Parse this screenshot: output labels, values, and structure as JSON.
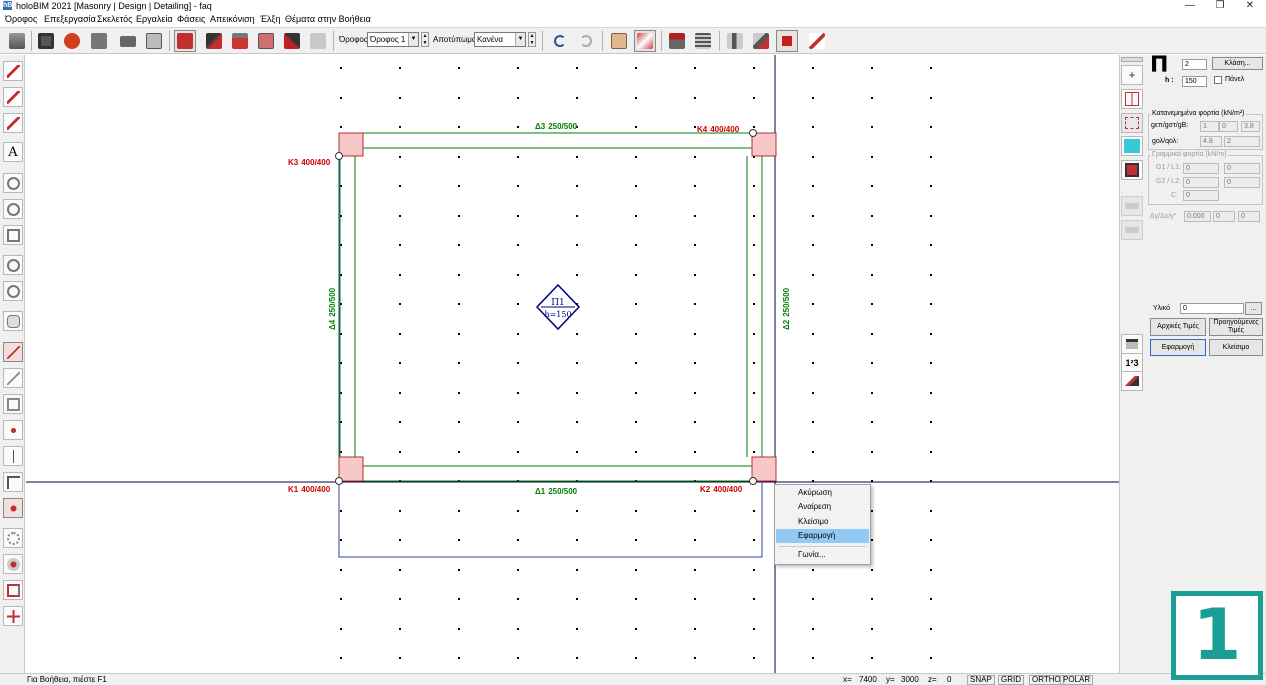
{
  "window": {
    "title": "holoBIM 2021 [Masonry | Design | Detailing] - faq",
    "app_icon": "hB",
    "controls": {
      "minimize": "—",
      "maximize": "❐",
      "close": "✕"
    }
  },
  "menu": [
    "Όροφος",
    "Επεξεργασία",
    "Σκελετός",
    "Εργαλεία",
    "Φάσεις",
    "Απεικόνιση",
    "Έλξη",
    "Θέματα στην Βοήθεια"
  ],
  "toolbar": {
    "floor_label": "Όροφος",
    "floor_value": "Όροφος 1",
    "imprint_label": "Αποτύπωμα",
    "imprint_value": "Κανένα",
    "spin_up": "▲",
    "spin_down": "▼",
    "dropdown_arrow": "▼"
  },
  "canvas": {
    "beams": [
      {
        "id": "Δ3",
        "label": "250/500",
        "color": "#008000"
      },
      {
        "id": "Δ1",
        "label": "250/500",
        "color": "#008000"
      },
      {
        "id": "Δ4",
        "label": "250/500",
        "color": "#008000"
      },
      {
        "id": "Δ2",
        "label": "250/500",
        "color": "#008000"
      }
    ],
    "columns": [
      {
        "id": "K3",
        "label": "400/400",
        "color": "#cc0000"
      },
      {
        "id": "K4",
        "label": "400/400",
        "color": "#cc0000"
      },
      {
        "id": "K1",
        "label": "400/400",
        "color": "#cc0000"
      },
      {
        "id": "K2",
        "label": "400/400",
        "color": "#cc0000"
      }
    ],
    "slab": {
      "id": "Π1",
      "thickness": "h=150",
      "color": "#000080"
    }
  },
  "context_menu": {
    "items": [
      "Ακύρωση",
      "Αναίρεση",
      "Κλείσιμο",
      "Εφαρμογή",
      "Γωνία..."
    ],
    "highlighted": "Εφαρμογή"
  },
  "panel": {
    "symbol": "Π",
    "id_value": "2",
    "h_label": "h :",
    "h_value": "150",
    "class_button": "Κλάση...",
    "panel_checkbox_label": "Πάνελ",
    "distributed_title": "Κατανεμημένα φορτία (kN/m²)",
    "row1_label": "gεπ/gστ/gΒ:",
    "row1_values": [
      "1",
      "0",
      "3.8"
    ],
    "row2_label": "gολ/qολ:",
    "row2_values": [
      "4.8",
      "2"
    ],
    "linear_title": "Γραμμικά φορτία (kN/m)",
    "g1_label": "G1 / L1:",
    "g1_values": [
      "0",
      "0"
    ],
    "g2_label": "G2 / L2:",
    "g2_values": [
      "0",
      "0"
    ],
    "c_label": "C:",
    "c_value": "0",
    "dg_label": "Δγ/Δx/γ°",
    "dg_values": [
      "0.000",
      "0",
      "0"
    ],
    "material_label": "Υλικό",
    "material_value": "0",
    "material_button": "...",
    "initial_button": "Αρχικές Τιμές",
    "previous_button": "Προηγούμενες Τιμές",
    "apply_button": "Εφαρμογή",
    "close_button": "Κλείσιμο",
    "tool_numbering": "1²3"
  },
  "status": {
    "help": "Για Βοήθεια, πιέστε F1",
    "x_label": "x=",
    "x_value": "7400",
    "y_label": "y=",
    "y_value": "3000",
    "z_label": "z=",
    "z_value": "0",
    "snap": "SNAP",
    "grid": "GRID",
    "ortho": "ORTHO",
    "polar": "POLAR"
  },
  "badge": "1",
  "colors": {
    "accent_teal": "#1b9e95",
    "highlight_blue": "#91c9f7",
    "column_fill": "#f7c8c8",
    "beam_green": "#008000"
  }
}
